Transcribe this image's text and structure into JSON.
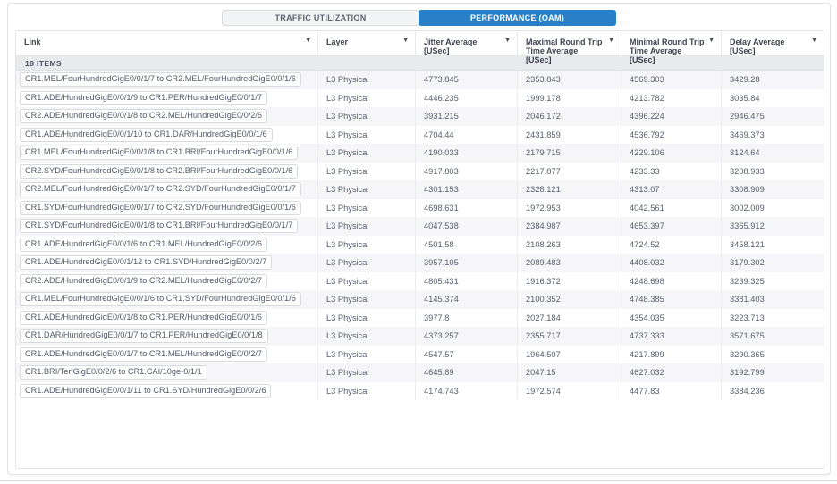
{
  "colors": {
    "accent": "#2a80c6",
    "items_bar_bg": "#e9eaed",
    "stripe_bg": "#f6f6f8"
  },
  "tabs": [
    {
      "label": "TRAFFIC UTILIZATION",
      "active": false
    },
    {
      "label": "PERFORMANCE (OAM)",
      "active": true
    }
  ],
  "table": {
    "items_count_label": "18 ITEMS",
    "columns": [
      "Link",
      "Layer",
      "Jitter Average [USec]",
      "Maximal Round Trip Time Average [USec]",
      "Minimal Round Trip Time Average [USec]",
      "Delay Average [USec]"
    ],
    "rows": [
      {
        "link": "CR1.MEL/FourHundredGigE0/0/1/7 to CR2.MEL/FourHundredGigE0/0/1/6",
        "layer": "L3 Physical",
        "jitter": "4773.845",
        "max_rtt": "2353.843",
        "min_rtt": "4569.303",
        "delay": "3429.28"
      },
      {
        "link": "CR1.ADE/HundredGigE0/0/1/9 to CR1.PER/HundredGigE0/0/1/7",
        "layer": "L3 Physical",
        "jitter": "4446.235",
        "max_rtt": "1999.178",
        "min_rtt": "4213.782",
        "delay": "3035.84"
      },
      {
        "link": "CR2.ADE/HundredGigE0/0/1/8 to CR2.MEL/HundredGigE0/0/2/6",
        "layer": "L3 Physical",
        "jitter": "3931.215",
        "max_rtt": "2046.172",
        "min_rtt": "4396.224",
        "delay": "2946.475"
      },
      {
        "link": "CR1.ADE/HundredGigE0/0/1/10 to CR1.DAR/HundredGigE0/0/1/6",
        "layer": "L3 Physical",
        "jitter": "4704.44",
        "max_rtt": "2431.859",
        "min_rtt": "4536.792",
        "delay": "3469.373"
      },
      {
        "link": "CR1.MEL/FourHundredGigE0/0/1/8 to CR1.BRI/FourHundredGigE0/0/1/6",
        "layer": "L3 Physical",
        "jitter": "4190.033",
        "max_rtt": "2179.715",
        "min_rtt": "4229.106",
        "delay": "3124.64"
      },
      {
        "link": "CR2.SYD/FourHundredGigE0/0/1/8 to CR2.BRI/FourHundredGigE0/0/1/6",
        "layer": "L3 Physical",
        "jitter": "4917.803",
        "max_rtt": "2217.877",
        "min_rtt": "4233.33",
        "delay": "3208.933"
      },
      {
        "link": "CR2.MEL/FourHundredGigE0/0/1/7 to CR2.SYD/FourHundredGigE0/0/1/7",
        "layer": "L3 Physical",
        "jitter": "4301.153",
        "max_rtt": "2328.121",
        "min_rtt": "4313.07",
        "delay": "3308.909"
      },
      {
        "link": "CR1.SYD/FourHundredGigE0/0/1/7 to CR2.SYD/FourHundredGigE0/0/1/6",
        "layer": "L3 Physical",
        "jitter": "4698.631",
        "max_rtt": "1972.953",
        "min_rtt": "4042.561",
        "delay": "3002.009"
      },
      {
        "link": "CR1.SYD/FourHundredGigE0/0/1/8 to CR1.BRI/FourHundredGigE0/0/1/7",
        "layer": "L3 Physical",
        "jitter": "4047.538",
        "max_rtt": "2384.987",
        "min_rtt": "4653.397",
        "delay": "3365.912"
      },
      {
        "link": "CR1.ADE/HundredGigE0/0/1/6 to CR1.MEL/HundredGigE0/0/2/6",
        "layer": "L3 Physical",
        "jitter": "4501.58",
        "max_rtt": "2108.263",
        "min_rtt": "4724.52",
        "delay": "3458.121"
      },
      {
        "link": "CR1.ADE/HundredGigE0/0/1/12 to CR1.SYD/HundredGigE0/0/2/7",
        "layer": "L3 Physical",
        "jitter": "3957.105",
        "max_rtt": "2089.483",
        "min_rtt": "4408.032",
        "delay": "3179.302"
      },
      {
        "link": "CR2.ADE/HundredGigE0/0/1/9 to CR2.MEL/HundredGigE0/0/2/7",
        "layer": "L3 Physical",
        "jitter": "4805.431",
        "max_rtt": "1916.372",
        "min_rtt": "4248.698",
        "delay": "3239.325"
      },
      {
        "link": "CR1.MEL/FourHundredGigE0/0/1/6 to CR1.SYD/FourHundredGigE0/0/1/6",
        "layer": "L3 Physical",
        "jitter": "4145.374",
        "max_rtt": "2100.352",
        "min_rtt": "4748.385",
        "delay": "3381.403"
      },
      {
        "link": "CR1.ADE/HundredGigE0/0/1/8 to CR1.PER/HundredGigE0/0/1/6",
        "layer": "L3 Physical",
        "jitter": "3977.8",
        "max_rtt": "2027.184",
        "min_rtt": "4354.035",
        "delay": "3223.713"
      },
      {
        "link": "CR1.DAR/HundredGigE0/0/1/7 to CR1.PER/HundredGigE0/0/1/8",
        "layer": "L3 Physical",
        "jitter": "4373.257",
        "max_rtt": "2355.717",
        "min_rtt": "4737.333",
        "delay": "3571.675"
      },
      {
        "link": "CR1.ADE/HundredGigE0/0/1/7 to CR1.MEL/HundredGigE0/0/2/7",
        "layer": "L3 Physical",
        "jitter": "4547.57",
        "max_rtt": "1964.507",
        "min_rtt": "4217.899",
        "delay": "3290.365"
      },
      {
        "link": "CR1.BRI/TenGigE0/0/2/6 to CR1.CAI/10ge-0/1/1",
        "layer": "L3 Physical",
        "jitter": "4645.89",
        "max_rtt": "2047.15",
        "min_rtt": "4627.032",
        "delay": "3192.799"
      },
      {
        "link": "CR1.ADE/HundredGigE0/0/1/11 to CR1.SYD/HundredGigE0/0/2/6",
        "layer": "L3 Physical",
        "jitter": "4174.743",
        "max_rtt": "1972.574",
        "min_rtt": "4477.83",
        "delay": "3384.236"
      }
    ]
  }
}
